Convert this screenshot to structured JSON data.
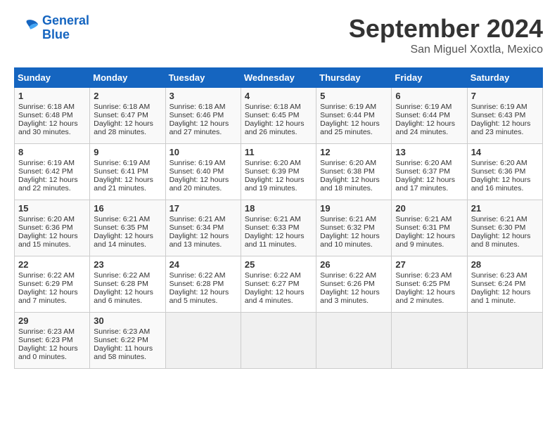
{
  "logo": {
    "line1": "General",
    "line2": "Blue"
  },
  "title": "September 2024",
  "location": "San Miguel Xoxtla, Mexico",
  "days_of_week": [
    "Sunday",
    "Monday",
    "Tuesday",
    "Wednesday",
    "Thursday",
    "Friday",
    "Saturday"
  ],
  "weeks": [
    [
      {
        "day": "1",
        "sunrise": "6:18 AM",
        "sunset": "6:48 PM",
        "daylight": "12 hours and 30 minutes."
      },
      {
        "day": "2",
        "sunrise": "6:18 AM",
        "sunset": "6:47 PM",
        "daylight": "12 hours and 28 minutes."
      },
      {
        "day": "3",
        "sunrise": "6:18 AM",
        "sunset": "6:46 PM",
        "daylight": "12 hours and 27 minutes."
      },
      {
        "day": "4",
        "sunrise": "6:18 AM",
        "sunset": "6:45 PM",
        "daylight": "12 hours and 26 minutes."
      },
      {
        "day": "5",
        "sunrise": "6:19 AM",
        "sunset": "6:44 PM",
        "daylight": "12 hours and 25 minutes."
      },
      {
        "day": "6",
        "sunrise": "6:19 AM",
        "sunset": "6:44 PM",
        "daylight": "12 hours and 24 minutes."
      },
      {
        "day": "7",
        "sunrise": "6:19 AM",
        "sunset": "6:43 PM",
        "daylight": "12 hours and 23 minutes."
      }
    ],
    [
      {
        "day": "8",
        "sunrise": "6:19 AM",
        "sunset": "6:42 PM",
        "daylight": "12 hours and 22 minutes."
      },
      {
        "day": "9",
        "sunrise": "6:19 AM",
        "sunset": "6:41 PM",
        "daylight": "12 hours and 21 minutes."
      },
      {
        "day": "10",
        "sunrise": "6:19 AM",
        "sunset": "6:40 PM",
        "daylight": "12 hours and 20 minutes."
      },
      {
        "day": "11",
        "sunrise": "6:20 AM",
        "sunset": "6:39 PM",
        "daylight": "12 hours and 19 minutes."
      },
      {
        "day": "12",
        "sunrise": "6:20 AM",
        "sunset": "6:38 PM",
        "daylight": "12 hours and 18 minutes."
      },
      {
        "day": "13",
        "sunrise": "6:20 AM",
        "sunset": "6:37 PM",
        "daylight": "12 hours and 17 minutes."
      },
      {
        "day": "14",
        "sunrise": "6:20 AM",
        "sunset": "6:36 PM",
        "daylight": "12 hours and 16 minutes."
      }
    ],
    [
      {
        "day": "15",
        "sunrise": "6:20 AM",
        "sunset": "6:36 PM",
        "daylight": "12 hours and 15 minutes."
      },
      {
        "day": "16",
        "sunrise": "6:21 AM",
        "sunset": "6:35 PM",
        "daylight": "12 hours and 14 minutes."
      },
      {
        "day": "17",
        "sunrise": "6:21 AM",
        "sunset": "6:34 PM",
        "daylight": "12 hours and 13 minutes."
      },
      {
        "day": "18",
        "sunrise": "6:21 AM",
        "sunset": "6:33 PM",
        "daylight": "12 hours and 11 minutes."
      },
      {
        "day": "19",
        "sunrise": "6:21 AM",
        "sunset": "6:32 PM",
        "daylight": "12 hours and 10 minutes."
      },
      {
        "day": "20",
        "sunrise": "6:21 AM",
        "sunset": "6:31 PM",
        "daylight": "12 hours and 9 minutes."
      },
      {
        "day": "21",
        "sunrise": "6:21 AM",
        "sunset": "6:30 PM",
        "daylight": "12 hours and 8 minutes."
      }
    ],
    [
      {
        "day": "22",
        "sunrise": "6:22 AM",
        "sunset": "6:29 PM",
        "daylight": "12 hours and 7 minutes."
      },
      {
        "day": "23",
        "sunrise": "6:22 AM",
        "sunset": "6:28 PM",
        "daylight": "12 hours and 6 minutes."
      },
      {
        "day": "24",
        "sunrise": "6:22 AM",
        "sunset": "6:28 PM",
        "daylight": "12 hours and 5 minutes."
      },
      {
        "day": "25",
        "sunrise": "6:22 AM",
        "sunset": "6:27 PM",
        "daylight": "12 hours and 4 minutes."
      },
      {
        "day": "26",
        "sunrise": "6:22 AM",
        "sunset": "6:26 PM",
        "daylight": "12 hours and 3 minutes."
      },
      {
        "day": "27",
        "sunrise": "6:23 AM",
        "sunset": "6:25 PM",
        "daylight": "12 hours and 2 minutes."
      },
      {
        "day": "28",
        "sunrise": "6:23 AM",
        "sunset": "6:24 PM",
        "daylight": "12 hours and 1 minute."
      }
    ],
    [
      {
        "day": "29",
        "sunrise": "6:23 AM",
        "sunset": "6:23 PM",
        "daylight": "12 hours and 0 minutes."
      },
      {
        "day": "30",
        "sunrise": "6:23 AM",
        "sunset": "6:22 PM",
        "daylight": "11 hours and 58 minutes."
      },
      null,
      null,
      null,
      null,
      null
    ]
  ]
}
